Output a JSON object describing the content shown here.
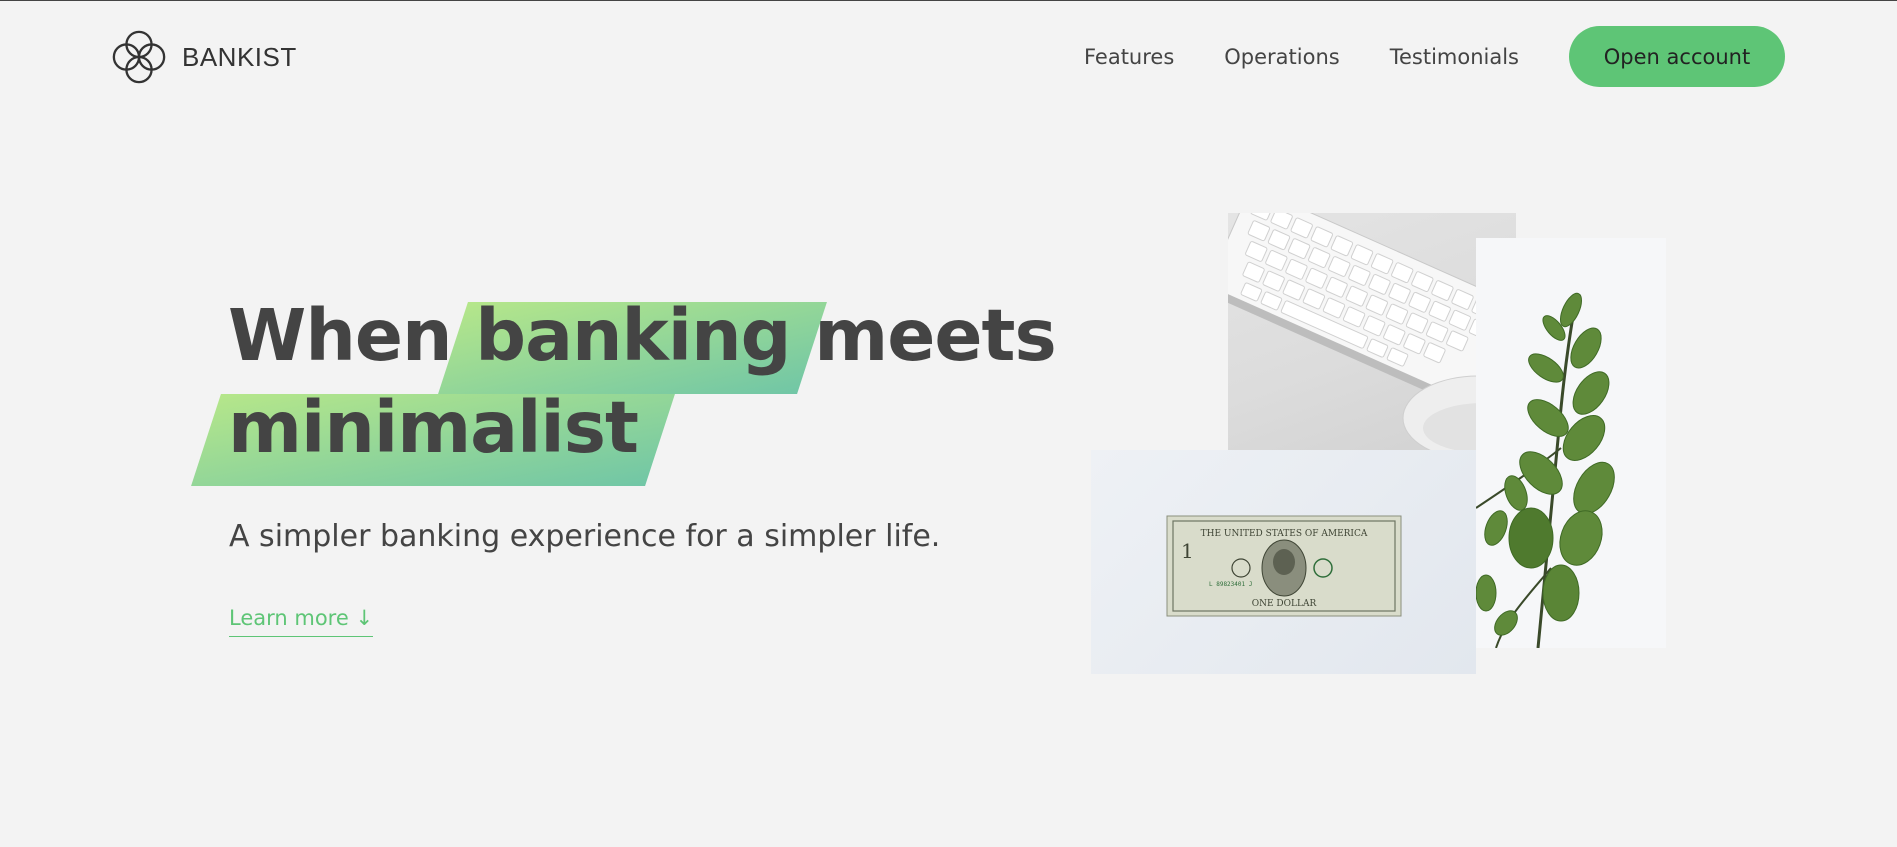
{
  "brand": {
    "name": "BANKIST",
    "logo_icon": "four-circles-logo-icon"
  },
  "nav": {
    "links": [
      "Features",
      "Operations",
      "Testimonials"
    ],
    "cta_label": "Open account",
    "cta_color": "#5ec576"
  },
  "hero": {
    "title_word_1": "When",
    "title_highlight_1": "banking",
    "title_word_2": "meets",
    "title_highlight_2": "minimalist",
    "subtitle": "A simpler banking experience for a simpler life.",
    "learn_more": "Learn more ↓",
    "accent_color": "#5ec576"
  },
  "images": {
    "keyboard": "keyboard-and-mouse-photo",
    "plant": "eucalyptus-plant-photo",
    "dollar": "one-dollar-bill-photo"
  },
  "dollar_bill": {
    "top_text": "THE UNITED STATES OF AMERICA",
    "bottom_text": "ONE DOLLAR",
    "serial": "L 89823401 J",
    "denomination": "1"
  }
}
